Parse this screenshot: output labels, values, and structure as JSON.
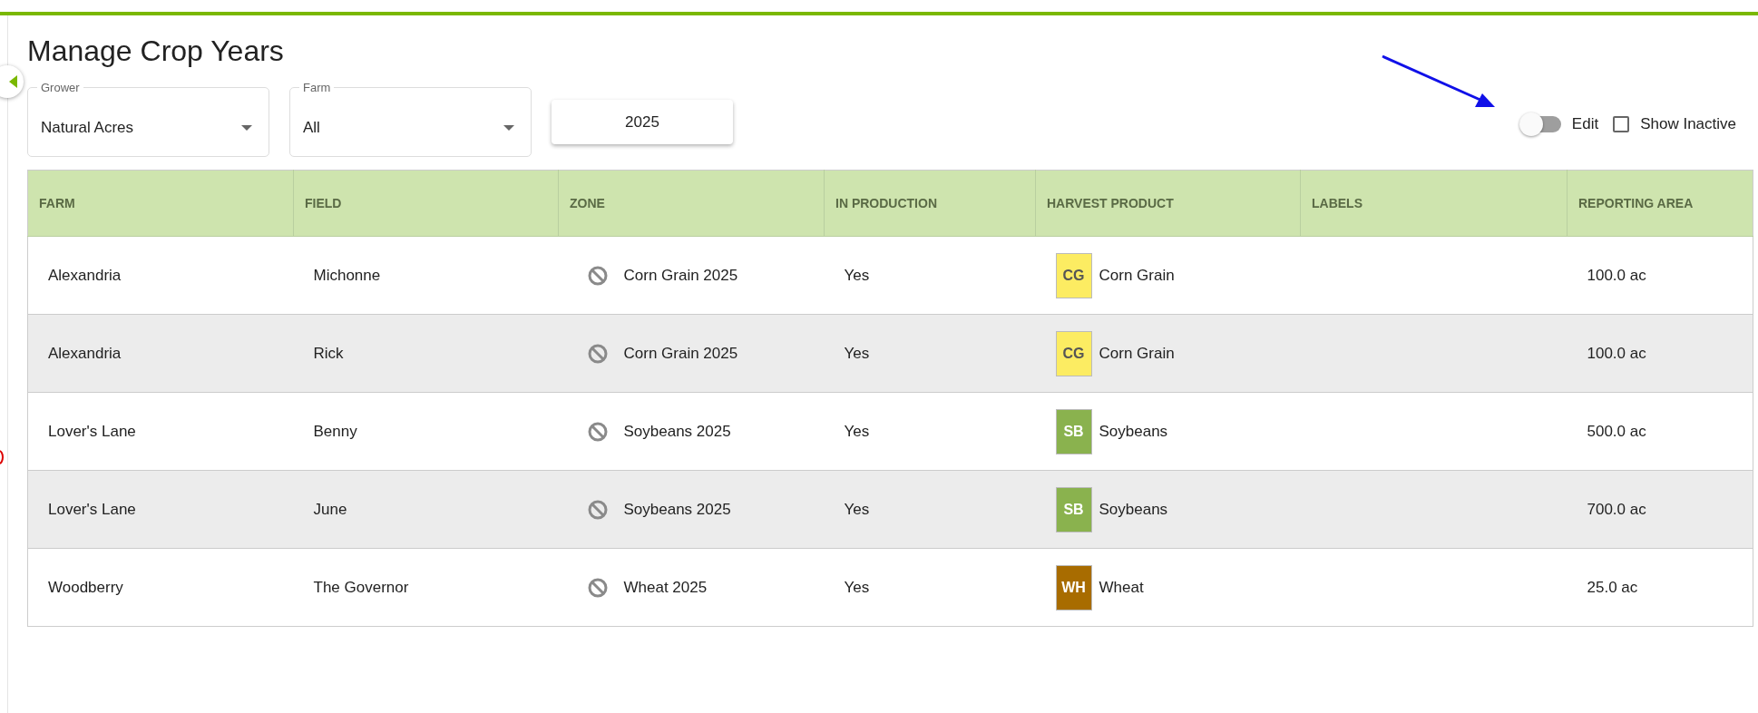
{
  "title": "Manage Crop Years",
  "filters": {
    "grower": {
      "label": "Grower",
      "value": "Natural Acres"
    },
    "farm": {
      "label": "Farm",
      "value": "All"
    },
    "year": "2025"
  },
  "controls": {
    "edit": {
      "label": "Edit",
      "on": false
    },
    "show_inactive": {
      "label": "Show Inactive",
      "checked": false
    }
  },
  "table": {
    "columns": [
      "FARM",
      "FIELD",
      "ZONE",
      "IN PRODUCTION",
      "HARVEST PRODUCT",
      "LABELS",
      "REPORTING AREA"
    ],
    "rows": [
      {
        "farm": "Alexandria",
        "field": "Michonne",
        "zone": "Corn Grain 2025",
        "in_production": "Yes",
        "product": {
          "code": "CG",
          "name": "Corn Grain",
          "color": "#fcec62"
        },
        "area": "100.0 ac"
      },
      {
        "farm": "Alexandria",
        "field": "Rick",
        "zone": "Corn Grain 2025",
        "in_production": "Yes",
        "product": {
          "code": "CG",
          "name": "Corn Grain",
          "color": "#fcec62"
        },
        "area": "100.0 ac"
      },
      {
        "farm": "Lover's Lane",
        "field": "Benny",
        "zone": "Soybeans 2025",
        "in_production": "Yes",
        "product": {
          "code": "SB",
          "name": "Soybeans",
          "color": "#8ab24e"
        },
        "area": "500.0 ac"
      },
      {
        "farm": "Lover's Lane",
        "field": "June",
        "zone": "Soybeans 2025",
        "in_production": "Yes",
        "product": {
          "code": "SB",
          "name": "Soybeans",
          "color": "#8ab24e"
        },
        "area": "700.0 ac"
      },
      {
        "farm": "Woodberry",
        "field": "The Governor",
        "zone": "Wheat 2025",
        "in_production": "Yes",
        "product": {
          "code": "WH",
          "name": "Wheat",
          "color": "#a86c00"
        },
        "area": "25.0 ac"
      }
    ]
  }
}
